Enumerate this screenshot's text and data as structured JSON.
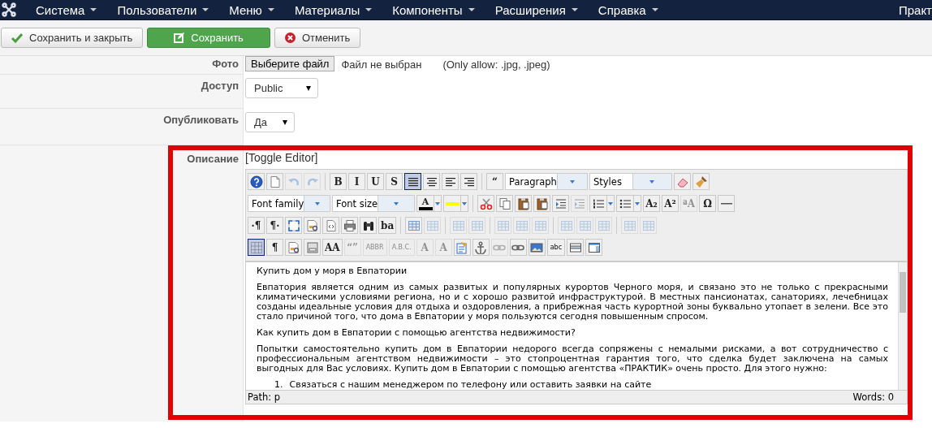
{
  "navbar": {
    "menu": [
      "Система",
      "Пользователи",
      "Меню",
      "Материалы",
      "Компоненты",
      "Расширения",
      "Справка"
    ],
    "user": "Практ"
  },
  "actions": [
    {
      "kind": "save-close",
      "label": "Сохранить и закрыть"
    },
    {
      "kind": "save",
      "label": "Сохранить"
    },
    {
      "kind": "cancel",
      "label": "Отменить"
    }
  ],
  "form": {
    "photo": {
      "label": "Фото",
      "button": "Выберите файл",
      "status": "Файл не выбран",
      "hint": "(Only allow: .jpg, .jpeg)"
    },
    "access": {
      "label": "Доступ",
      "value": "Public"
    },
    "published": {
      "label": "Опубликовать",
      "value": "Да"
    },
    "description": {
      "label": "Описание",
      "toggle": "[Toggle Editor]"
    }
  },
  "editor": {
    "toolbar_rows": [
      {
        "items": [
          {
            "kind": "help",
            "disabled": false,
            "selected": false
          },
          {
            "kind": "document",
            "disabled": false,
            "selected": false
          },
          {
            "kind": "undo",
            "disabled": true,
            "selected": false
          },
          {
            "kind": "redo",
            "disabled": true,
            "selected": false
          },
          {
            "kind": "separator"
          },
          {
            "kind": "glyph",
            "glyph": "B",
            "disabled": false,
            "selected": false
          },
          {
            "kind": "glyph",
            "glyph": "I",
            "disabled": false,
            "selected": false
          },
          {
            "kind": "glyph",
            "glyph": "U",
            "disabled": false,
            "selected": false
          },
          {
            "kind": "glyph",
            "glyph": "S",
            "disabled": false,
            "selected": false
          },
          {
            "kind": "justify",
            "disabled": false,
            "selected": true
          },
          {
            "kind": "center",
            "disabled": false,
            "selected": false
          },
          {
            "kind": "left",
            "disabled": false,
            "selected": false
          },
          {
            "kind": "right",
            "disabled": false,
            "selected": false
          },
          {
            "kind": "separator"
          },
          {
            "kind": "glyph",
            "glyph": "“",
            "disabled": false,
            "selected": false
          },
          {
            "kind": "select",
            "value": "Paragraph"
          },
          {
            "kind": "select",
            "value": "Styles"
          },
          {
            "kind": "eraser",
            "disabled": false,
            "selected": false
          },
          {
            "kind": "brush",
            "disabled": false,
            "selected": false
          }
        ]
      },
      {
        "items": [
          {
            "kind": "select",
            "value": "Font family"
          },
          {
            "kind": "select",
            "value": "Font size"
          },
          {
            "kind": "color",
            "glyph": "A",
            "color": "#000000"
          },
          {
            "kind": "color",
            "color": "#ffff00"
          },
          {
            "kind": "separator"
          },
          {
            "kind": "scissors",
            "disabled": false,
            "selected": false
          },
          {
            "kind": "copy",
            "disabled": false,
            "selected": false
          },
          {
            "kind": "paste",
            "disabled": false,
            "selected": false
          },
          {
            "kind": "paste",
            "disabled": false,
            "selected": false
          },
          {
            "kind": "indent",
            "disabled": false,
            "selected": false
          },
          {
            "kind": "indent",
            "disabled": true,
            "selected": false
          },
          {
            "kind": "numlist",
            "disabled": false,
            "selected": false
          },
          {
            "kind": "bullist",
            "disabled": false,
            "selected": false
          },
          {
            "kind": "glyph",
            "glyph": "A₂",
            "disabled": false,
            "selected": false
          },
          {
            "kind": "glyph",
            "glyph": "A²",
            "disabled": false,
            "selected": false
          },
          {
            "kind": "glyph",
            "glyph": "ªA",
            "disabled": true,
            "selected": false
          },
          {
            "kind": "glyph",
            "glyph": "Ω",
            "disabled": false,
            "selected": false
          },
          {
            "kind": "hr",
            "disabled": false,
            "selected": false
          }
        ]
      },
      {
        "items": [
          {
            "kind": "glyph",
            "glyph": "·¶",
            "disabled": false,
            "selected": false
          },
          {
            "kind": "glyph",
            "glyph": "¶·",
            "disabled": false,
            "selected": false
          },
          {
            "kind": "fullscreen",
            "disabled": false,
            "selected": false
          },
          {
            "kind": "preview",
            "disabled": false,
            "selected": false
          },
          {
            "kind": "code",
            "disabled": false,
            "selected": false
          },
          {
            "kind": "print",
            "disabled": false,
            "selected": false
          },
          {
            "kind": "binoculars",
            "disabled": false,
            "selected": false
          },
          {
            "kind": "glyph",
            "glyph": "ba",
            "disabled": false,
            "selected": false
          },
          {
            "kind": "separator"
          },
          {
            "kind": "table",
            "disabled": false,
            "selected": false
          },
          {
            "kind": "table",
            "disabled": true,
            "selected": false
          },
          {
            "kind": "separator"
          },
          {
            "kind": "table",
            "disabled": true,
            "selected": false
          },
          {
            "kind": "table",
            "disabled": true,
            "selected": false
          },
          {
            "kind": "separator"
          },
          {
            "kind": "table",
            "disabled": true,
            "selected": false
          },
          {
            "kind": "table",
            "disabled": true,
            "selected": false
          },
          {
            "kind": "table",
            "disabled": true,
            "selected": false
          },
          {
            "kind": "separator"
          },
          {
            "kind": "table",
            "disabled": true,
            "selected": false
          },
          {
            "kind": "table",
            "disabled": true,
            "selected": false
          },
          {
            "kind": "table",
            "disabled": true,
            "selected": false
          },
          {
            "kind": "separator"
          },
          {
            "kind": "table",
            "disabled": true,
            "selected": false
          },
          {
            "kind": "table",
            "disabled": true,
            "selected": false
          }
        ]
      },
      {
        "items": [
          {
            "kind": "grid",
            "disabled": false,
            "selected": true
          },
          {
            "kind": "glyph",
            "glyph": "¶",
            "disabled": false,
            "selected": false
          },
          {
            "kind": "preview",
            "disabled": false,
            "selected": false
          },
          {
            "kind": "pagebreak",
            "disabled": false,
            "selected": false
          },
          {
            "kind": "glyph",
            "glyph": "AA",
            "disabled": false,
            "selected": false
          },
          {
            "kind": "glyph",
            "glyph": "“”",
            "disabled": true,
            "selected": false
          },
          {
            "kind": "glyph",
            "glyph": "ABBR",
            "disabled": true,
            "selected": false
          },
          {
            "kind": "glyph",
            "glyph": "A.B.C.",
            "disabled": true,
            "selected": false
          },
          {
            "kind": "glyph",
            "glyph": "A",
            "disabled": true,
            "selected": false
          },
          {
            "kind": "glyph",
            "glyph": "A",
            "disabled": true,
            "selected": false
          },
          {
            "kind": "form",
            "disabled": false,
            "selected": false
          },
          {
            "kind": "anchor",
            "disabled": false,
            "selected": false
          },
          {
            "kind": "link",
            "disabled": true,
            "selected": false
          },
          {
            "kind": "link",
            "disabled": false,
            "selected": false
          },
          {
            "kind": "image",
            "disabled": false,
            "selected": false
          },
          {
            "kind": "glyph",
            "glyph": "abc",
            "disabled": false,
            "selected": false
          },
          {
            "kind": "panel",
            "disabled": false,
            "selected": false
          },
          {
            "kind": "window",
            "disabled": false,
            "selected": false
          }
        ]
      }
    ],
    "content": [
      {
        "kind": "p",
        "text": "Купить дом у моря в Евпатории"
      },
      {
        "kind": "p",
        "text": "Евпатория является одним из самых развитых и популярных курортов Черного моря, и связано это не только с прекрасными климатическими условиями региона, но и с хорошо развитой инфраструктурой. В местных пансионатах, санаториях, лечебницах созданы идеальные условия для отдыха и оздоровления, а прибрежная часть курортной зоны буквально утопает в зелени. Все это стало причиной того, что дома в Евпатории у моря пользуются сегодня повышенным спросом."
      },
      {
        "kind": "p",
        "text": "Как купить дом в Евпатории с помощью агентства недвижимости?"
      },
      {
        "kind": "p",
        "text": "Попытки самостоятельно купить дом в Евпатории недорого всегда сопряжены с немалыми рисками, а вот сотрудничество с профессиональным агентством недвижимости – это стопроцентная гарантия того, что сделка будет заключена на самых выгодных для Вас условиях. Купить дом в Евпатории с помощью агентства «ПРАКТИК» очень просто. Для этого нужно:"
      },
      {
        "kind": "list-item",
        "number": "1.",
        "text": "Связаться с нашим менеджером по телефону или оставить заявки на сайте"
      }
    ],
    "status": {
      "path": "Path: p",
      "words": "Words: 0"
    }
  }
}
